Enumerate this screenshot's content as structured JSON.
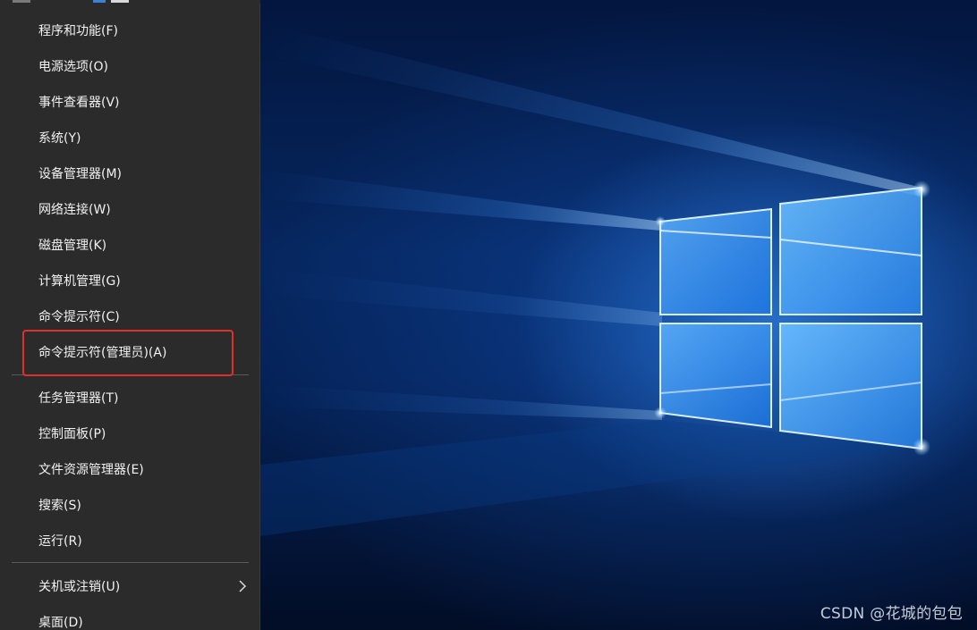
{
  "menu": {
    "items": [
      {
        "label": "程序和功能(F)"
      },
      {
        "label": "电源选项(O)"
      },
      {
        "label": "事件查看器(V)"
      },
      {
        "label": "系统(Y)"
      },
      {
        "label": "设备管理器(M)"
      },
      {
        "label": "网络连接(W)"
      },
      {
        "label": "磁盘管理(K)"
      },
      {
        "label": "计算机管理(G)"
      },
      {
        "label": "命令提示符(C)"
      },
      {
        "label": "命令提示符(管理员)(A)"
      },
      {
        "label": "任务管理器(T)"
      },
      {
        "label": "控制面板(P)"
      },
      {
        "label": "文件资源管理器(E)"
      },
      {
        "label": "搜索(S)"
      },
      {
        "label": "运行(R)"
      },
      {
        "label": "关机或注销(U)",
        "icon": "chevron-right-icon"
      },
      {
        "label": "桌面(D)"
      }
    ],
    "highlighted_item": "命令提示符(管理员)(A)",
    "highlight_color": "#e0302a",
    "background_color": "#2b2b2b",
    "text_color": "#f2f2f2"
  },
  "watermark": {
    "text": "CSDN @花城的包包"
  },
  "desktop": {
    "wallpaper": "windows-10-logo-wallpaper",
    "accent_color": "#1a7fe8"
  }
}
